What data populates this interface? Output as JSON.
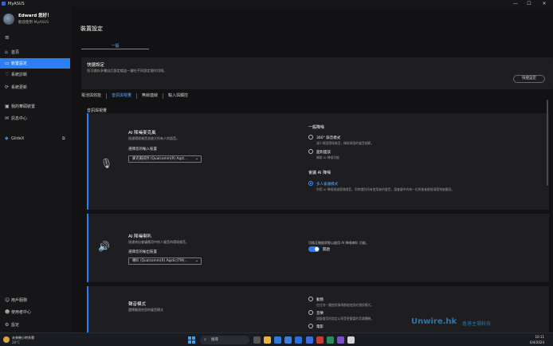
{
  "window": {
    "title": "MyASUS",
    "controls": [
      "—",
      "☐",
      "✕"
    ]
  },
  "user": {
    "name": "Edward 您好！",
    "subtitle": "歡迎使用 MyASUS"
  },
  "sidebar": {
    "items": [
      {
        "label": "首頁",
        "icon": "home-icon",
        "glyph": "⌂"
      },
      {
        "label": "裝置設定",
        "icon": "device-icon",
        "glyph": "▭",
        "active": true
      },
      {
        "label": "系統診斷",
        "icon": "diagnosis-icon",
        "glyph": "♡"
      },
      {
        "label": "系統更新",
        "icon": "update-icon",
        "glyph": "⟳"
      },
      {
        "label": "我的華碩裝置",
        "icon": "devices-icon",
        "glyph": "▣"
      },
      {
        "label": "訊息中心",
        "icon": "message-icon",
        "glyph": "✉"
      },
      {
        "label": "GlideX",
        "icon": "glidex-icon",
        "glyph": "◈",
        "ext": "⧉"
      },
      {
        "label": "用戶服務",
        "icon": "service-icon",
        "glyph": "☺"
      },
      {
        "label": "使用者中心",
        "icon": "user-center-icon",
        "glyph": "☻"
      },
      {
        "label": "設定",
        "icon": "settings-icon",
        "glyph": "⚙"
      }
    ]
  },
  "main": {
    "title": "裝置設定",
    "tab": "一般",
    "quick": {
      "title": "快捷設定",
      "desc": "您可儲存多種自訂設定檔並一鍵在不同設定間作切換。",
      "button": "快捷設定"
    },
    "subtabs": [
      "電池與效能",
      "音訊與視覺",
      "無線連線",
      "輸入與觸控"
    ],
    "section": "音訊與視覺",
    "cards": [
      {
        "title": "AI 降噪麥克風",
        "desc": "過濾環境噪音並放大所有人的語音。",
        "select_label": "選擇您的輸入裝置",
        "select_value": "麥克風排列 (Qualcomm(R) Aqst...",
        "group1": "一般降噪",
        "opt1": "360° 錄音模式",
        "opt1_sub": "減少周圍環境噪音，擷取周圍的聲音細節。",
        "opt2": "面對面談",
        "opt2_sub": "擷取 AI 降噪功能",
        "group2": "會議 AI 降噪",
        "opt3": "多人會議模式",
        "opt3_sub": "利用 AI 降噪過濾環境噪音，同時識別所有使用者的聲音，讓會議中的每一位與會者都能清楚地被聽見。"
      },
      {
        "title": "AI 降噪喇叭",
        "desc": "過濾來自會議應用中他人聲音的環境噪音。",
        "select_label": "選擇您的輸出裝置",
        "select_value": "喇叭 (Qualcomm(R) Aqstic(TM)...",
        "toggle_desc": "切換至開啟狀態以啟用 AI 降噪喇叭 功能。",
        "toggle_state": "開啟"
      },
      {
        "title": "聲音模式",
        "desc": "選擇最適合您的聲音模式",
        "opt_a": "動態",
        "opt_a_sub": "在任何一種使用情境都能使用的預設模式。",
        "opt_b": "音樂",
        "opt_b_sub": "調整聲音的設定以享受更豐富的音樂體驗。",
        "opt_c": "電影"
      }
    ]
  },
  "taskbar": {
    "weather": "未來幾小時多雲",
    "temp": "28°C",
    "search": "搜尋",
    "time": "10:11",
    "date": "6/4/2024"
  },
  "watermark": {
    "brand": "Unwire.hk",
    "tag": "香港主場科技"
  }
}
